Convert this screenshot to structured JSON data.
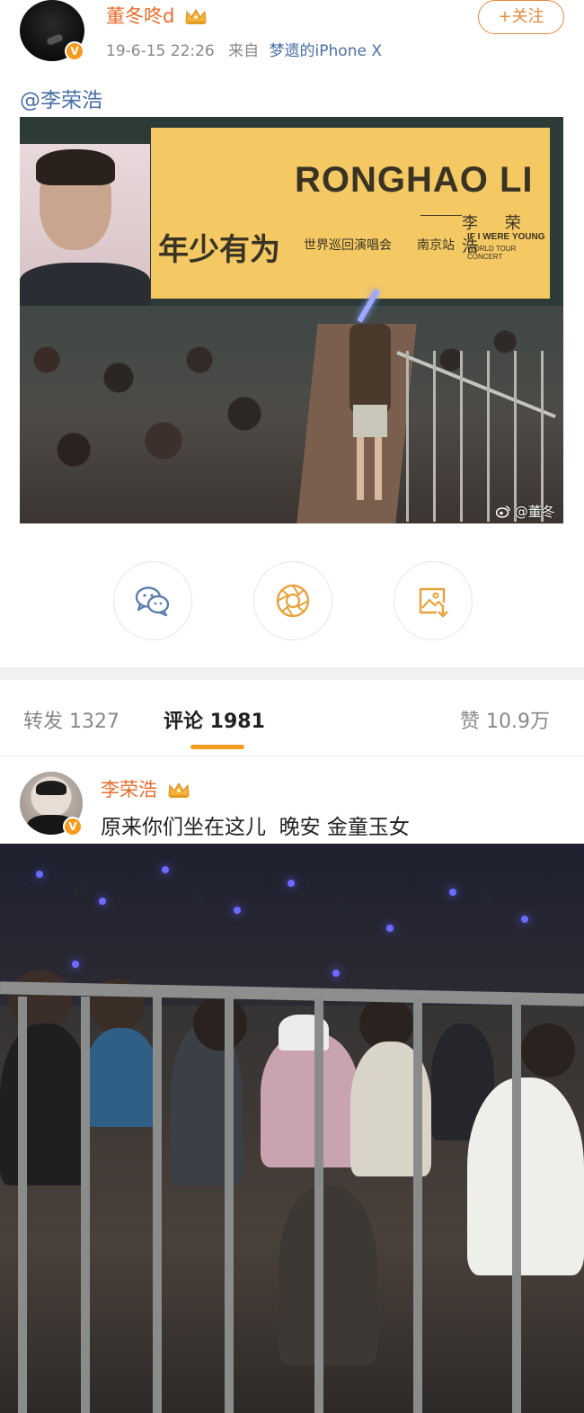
{
  "post": {
    "author": "董冬咚d",
    "verified_badge": "V",
    "timestamp": "19-6-15 22:26",
    "source_prefix": "来自",
    "source_device": "梦遗的iPhone X",
    "follow_label": "+关注",
    "mention": "@李荣浩"
  },
  "photo1": {
    "banner_title": "RONGHAO LI",
    "banner_name_zh": "李 荣浩",
    "banner_slogan": "年少有为",
    "banner_tour": "世界巡回演唱会",
    "banner_station": "南京站",
    "banner_en_line1": "IF I WERE YOUNG",
    "banner_en_line2": "WORLD TOUR CONCERT",
    "watermark": "@董冬咚d"
  },
  "actions": [
    {
      "name": "wechat-share",
      "icon": "wechat-icon"
    },
    {
      "name": "moments-share",
      "icon": "moments-icon"
    },
    {
      "name": "save-image",
      "icon": "save-image-icon"
    }
  ],
  "tabs": {
    "repost": "转发 1327",
    "comments": "评论 1981",
    "likes": "赞 10.9万"
  },
  "comment": {
    "author": "李荣浩",
    "verified_badge": "V",
    "text": "原来你们坐在这儿  晚安 金童玉女"
  },
  "colors": {
    "accent_orange": "#f39c1f",
    "name_orange": "#e86b2c",
    "link_blue": "#4a6fa5",
    "banner_yellow": "#f4c964"
  }
}
